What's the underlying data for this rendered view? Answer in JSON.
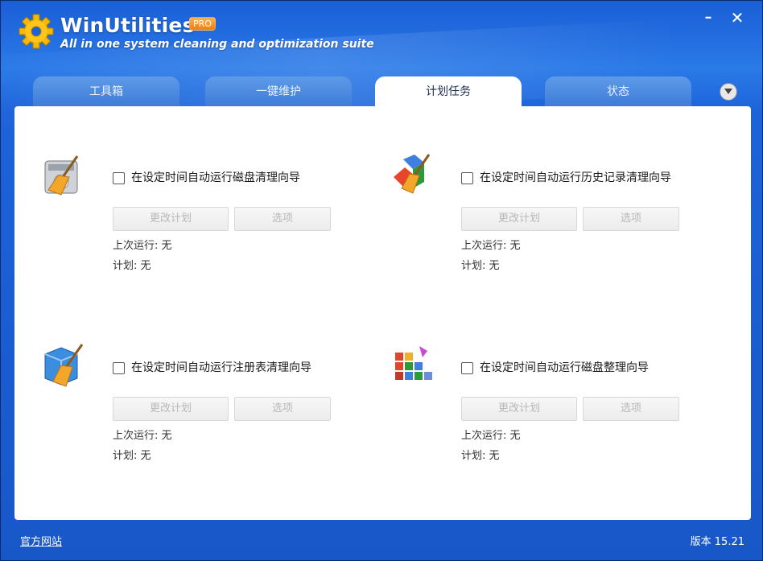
{
  "app": {
    "title": "WinUtilities",
    "badge": "PRO",
    "subtitle": "All in one system cleaning and optimization suite"
  },
  "window_controls": {
    "minimize": "–",
    "close": "✕"
  },
  "tabs": [
    {
      "label": "工具箱"
    },
    {
      "label": "一键维护"
    },
    {
      "label": "计划任务"
    },
    {
      "label": "状态"
    }
  ],
  "active_tab": "计划任务",
  "tasks": [
    {
      "icon": "disk-cleanup-icon",
      "label": "在设定时间自动运行磁盘清理向导",
      "checked": false,
      "change_btn": "更改计划",
      "options_btn": "选项",
      "last_run": "上次运行: 无",
      "schedule": "计划: 无"
    },
    {
      "icon": "history-cleanup-icon",
      "label": "在设定时间自动运行历史记录清理向导",
      "checked": false,
      "change_btn": "更改计划",
      "options_btn": "选项",
      "last_run": "上次运行: 无",
      "schedule": "计划: 无"
    },
    {
      "icon": "registry-cleanup-icon",
      "label": "在设定时间自动运行注册表清理向导",
      "checked": false,
      "change_btn": "更改计划",
      "options_btn": "选项",
      "last_run": "上次运行: 无",
      "schedule": "计划: 无"
    },
    {
      "icon": "disk-defrag-icon",
      "label": "在设定时间自动运行磁盘整理向导",
      "checked": false,
      "change_btn": "更改计划",
      "options_btn": "选项",
      "last_run": "上次运行: 无",
      "schedule": "计划: 无"
    }
  ],
  "footer": {
    "website_link": "官方网站",
    "version": "版本 15.21"
  },
  "colors": {
    "frame": "#1c63d9",
    "accent": "#f07c12",
    "panel": "#ffffff",
    "disabled_text": "#b8b8b8"
  }
}
